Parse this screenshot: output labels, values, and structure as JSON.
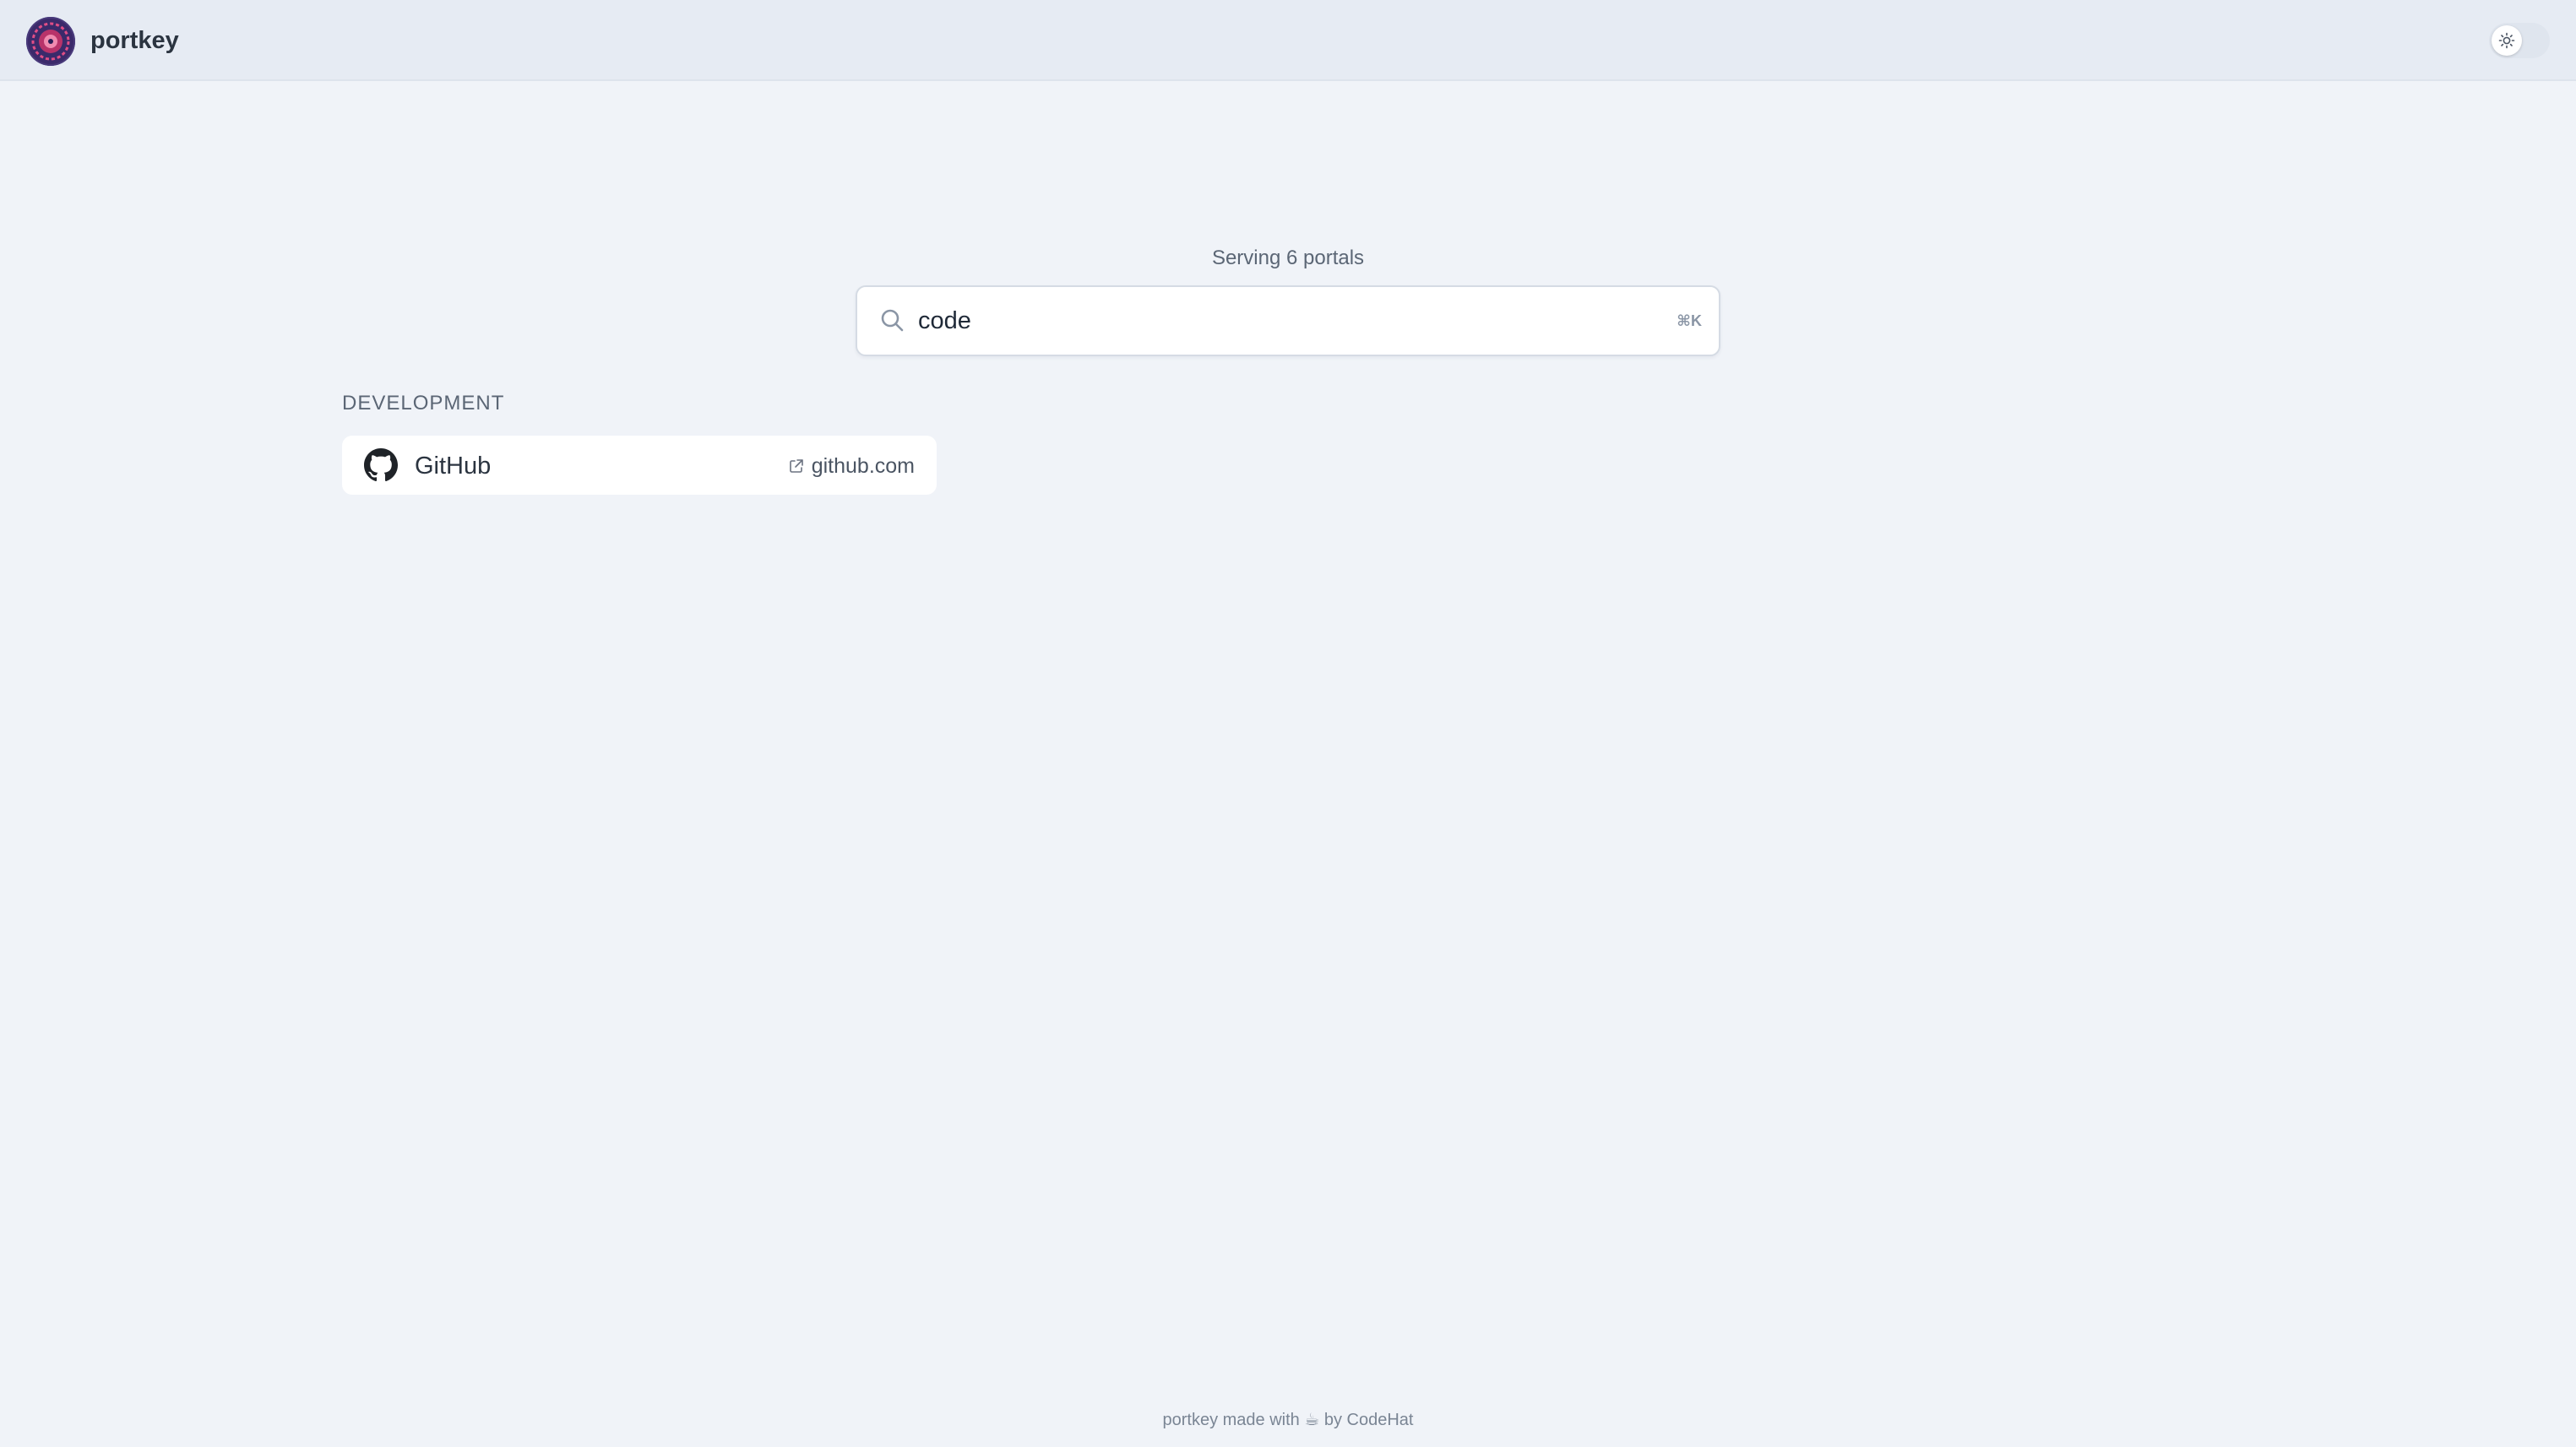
{
  "header": {
    "brand": "portkey",
    "logo_icon": "portkey-logo-icon",
    "theme_toggle_icon": "sun-icon"
  },
  "main": {
    "serving_text": "Serving 6 portals",
    "search": {
      "value": "code",
      "shortcut": "⌘K",
      "icon": "search-icon"
    },
    "categories": [
      {
        "label": "DEVELOPMENT",
        "portals": [
          {
            "name": "GitHub",
            "domain": "github.com",
            "icon": "github-icon",
            "link_icon": "external-link-icon"
          }
        ]
      }
    ]
  },
  "footer": {
    "text_before": "portkey made with",
    "emoji": "☕",
    "text_after": "by CodeHat"
  },
  "colors": {
    "background": "#f0f3f8",
    "header_background": "#e6ebf3",
    "card_background": "#ffffff",
    "text_primary": "#2b3440",
    "text_muted": "#5b6675"
  }
}
